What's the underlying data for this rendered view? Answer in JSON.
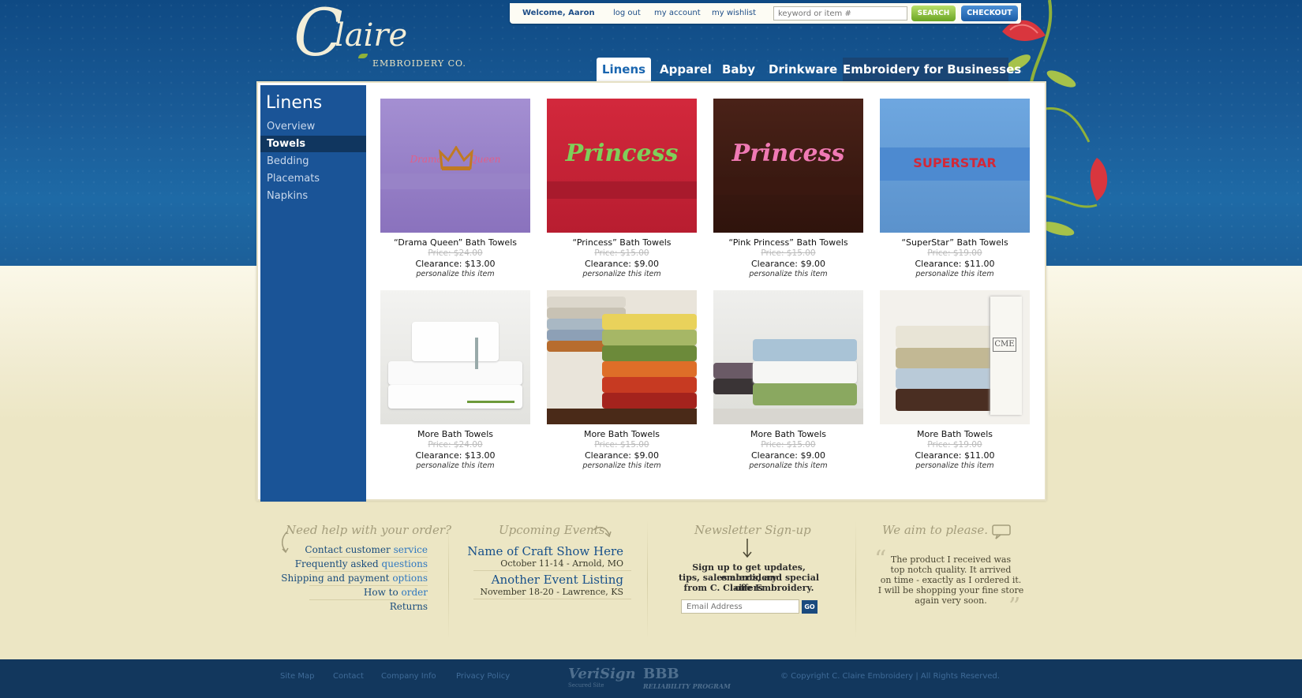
{
  "brand": {
    "logo_initial": "C",
    "logo_name": "laire",
    "logo_sub": "EMBROIDERY CO."
  },
  "topbar": {
    "welcome": "Welcome, Aaron",
    "logout": "log out",
    "account": "my account",
    "wishlist": "my wishlist",
    "search_placeholder": "keyword or item #",
    "search_button": "SEARCH",
    "checkout_button": "CHECKOUT"
  },
  "nav": {
    "tabs": [
      "Linens",
      "Apparel",
      "Baby",
      "Drinkware",
      "Embroidery for Businesses"
    ],
    "active": "Linens"
  },
  "sidebar": {
    "title": "Linens",
    "items": [
      "Overview",
      "Towels",
      "Bedding",
      "Placemats",
      "Napkins"
    ],
    "active": "Towels"
  },
  "products": [
    {
      "name": "“Drama Queen” Bath Towels",
      "price": "Price: $24.00",
      "clearance": "Clearance: $13.00",
      "personalize": "personalize this item",
      "embroidery": "Drama Queen",
      "color": "#9a82c8"
    },
    {
      "name": "“Princess” Bath Towels",
      "price": "Price: $15.00",
      "clearance": "Clearance: $9.00",
      "personalize": "personalize this item",
      "embroidery": "Princess",
      "color": "#c9283a"
    },
    {
      "name": "“Pink Princess” Bath Towels",
      "price": "Price: $15.00",
      "clearance": "Clearance: $9.00",
      "personalize": "personalize this item",
      "embroidery": "Princess",
      "color": "#3a1a14"
    },
    {
      "name": "“SuperStar” Bath Towels",
      "price": "Price: $19.00",
      "clearance": "Clearance: $11.00",
      "personalize": "personalize this item",
      "embroidery": "SUPERSTAR",
      "color": "#5b9ad6"
    },
    {
      "name": "More Bath Towels",
      "price": "Price: $24.00",
      "clearance": "Clearance: $13.00",
      "personalize": "personalize this item"
    },
    {
      "name": "More Bath Towels",
      "price": "Price: $15.00",
      "clearance": "Clearance: $9.00",
      "personalize": "personalize this item"
    },
    {
      "name": "More Bath Towels",
      "price": "Price: $15.00",
      "clearance": "Clearance: $9.00",
      "personalize": "personalize this item"
    },
    {
      "name": "More Bath Towels",
      "price": "Price: $19.00",
      "clearance": "Clearance: $11.00",
      "personalize": "personalize this item",
      "monogram": "CME"
    }
  ],
  "footer": {
    "help_title": "Need help with your order?",
    "help_links": [
      {
        "a": "Contact customer ",
        "b": "service"
      },
      {
        "a": "Frequently asked ",
        "b": "questions"
      },
      {
        "a": "Shipping and payment ",
        "b": "options"
      },
      {
        "a": "How to ",
        "b": "order"
      },
      {
        "a": "Returns",
        "b": ""
      }
    ],
    "events_title": "Upcoming Events",
    "events": [
      {
        "name": "Name of Craft Show Here",
        "date": "October 11-14 - Arnold, MO"
      },
      {
        "name": "Another Event Listing",
        "date": "November 18-20 - Lawrence, KS"
      }
    ],
    "newsletter_title": "Newsletter Sign-up",
    "newsletter_text_1": "Sign up to get updates, embroidery",
    "newsletter_text_2": "tips, sales alerts, and special offers",
    "newsletter_text_3": "from  C. Claire Embroidery.",
    "newsletter_placeholder": "Email Address",
    "newsletter_go": "GO",
    "quote_title": "We aim to please.",
    "quote_lines": [
      "The product I received was",
      "top notch quality. It arrived",
      "on time - exactly as I ordered it.",
      "I will be shopping your fine store",
      "again very soon."
    ]
  },
  "bottom": {
    "links": [
      "Site Map",
      "Contact",
      "Company Info",
      "Privacy Policy"
    ],
    "verisign": "VeriSign",
    "verisign_sub": "Secured Site",
    "bbb": "BBB",
    "bbb_sub": "RELIABILITY PROGRAM",
    "copyright": "© Copyright C. Claire Embroidery | All Rights Reserved."
  }
}
